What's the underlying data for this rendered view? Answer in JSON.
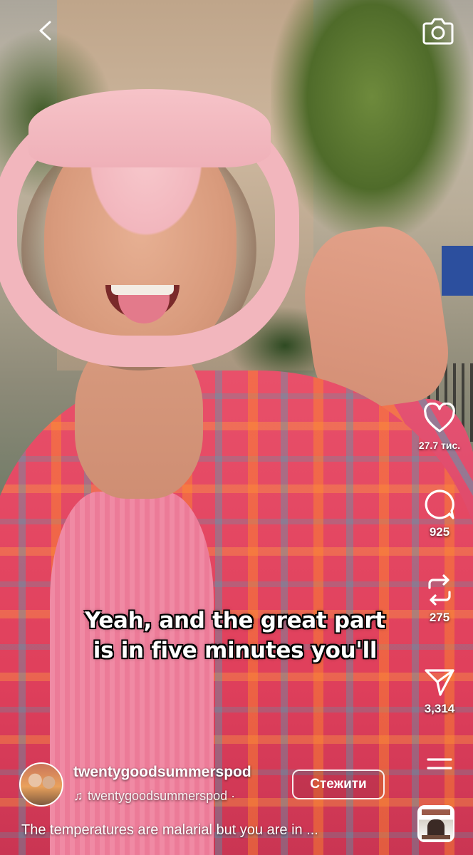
{
  "top_bar": {
    "back_icon": "chevron-left-icon",
    "camera_icon": "camera-icon"
  },
  "video": {
    "subtitle_lines": [
      "Yeah, and the great part",
      "is in five minutes you'll"
    ]
  },
  "actions": {
    "like": {
      "icon": "heart-icon",
      "count": "27.7 тис."
    },
    "comment": {
      "icon": "comment-bubble-icon",
      "count": "925"
    },
    "repost": {
      "icon": "repost-icon",
      "count": "275"
    },
    "share": {
      "icon": "paper-plane-icon",
      "count": "3,314"
    },
    "more": {
      "icon": "more-lines-icon"
    }
  },
  "footer": {
    "username": "twentygoodsummerspod",
    "audio_prefix_icon": "music-note-icon",
    "audio_text": "twentygoodsummerspod ·",
    "follow_label": "Стежити",
    "caption": "The temperatures are malarial but you are in ..."
  },
  "colors": {
    "text": "#ffffff",
    "overlay_shadow": "#000000"
  }
}
